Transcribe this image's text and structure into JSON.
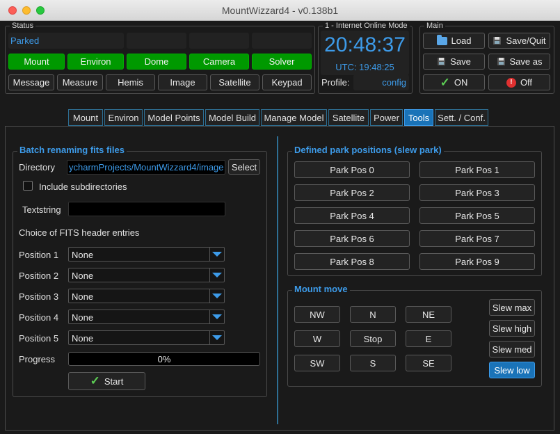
{
  "window": {
    "title": "MountWizzard4 - v0.138b1"
  },
  "status": {
    "group_title": "Status",
    "text": "Parked",
    "indicators": [
      "Mount",
      "Environ",
      "Dome",
      "Camera",
      "Solver"
    ],
    "buttons": [
      "Message",
      "Measure",
      "Hemis",
      "Image",
      "Satellite",
      "Keypad"
    ]
  },
  "online": {
    "group_title": "1 - Internet Online Mode",
    "time": "20:48:37",
    "utc": "UTC: 19:48:25",
    "profile_label": "Profile:",
    "profile_value": "config"
  },
  "main": {
    "group_title": "Main",
    "load": "Load",
    "save_quit": "Save/Quit",
    "save": "Save",
    "save_as": "Save as",
    "on": "ON",
    "off": "Off"
  },
  "tabs": [
    "Mount",
    "Environ",
    "Model Points",
    "Model Build",
    "Manage Model",
    "Satellite",
    "Power",
    "Tools",
    "Sett. / Conf."
  ],
  "active_tab": "Tools",
  "batch": {
    "title": "Batch renaming fits files",
    "directory_label": "Directory",
    "directory_value": "ycharmProjects/MountWizzard4/image",
    "select_button": "Select",
    "include_subdirs": "Include subdirectories",
    "include_subdirs_checked": false,
    "textstring_label": "Textstring",
    "textstring_value": "",
    "choice_label": "Choice of FITS header entries",
    "positions": [
      {
        "label": "Position 1",
        "value": "None"
      },
      {
        "label": "Position 2",
        "value": "None"
      },
      {
        "label": "Position 3",
        "value": "None"
      },
      {
        "label": "Position 4",
        "value": "None"
      },
      {
        "label": "Position 5",
        "value": "None"
      }
    ],
    "progress_label": "Progress",
    "progress_value": 0,
    "progress_text": "0%",
    "start_button": "Start"
  },
  "park": {
    "title": "Defined park positions (slew  park)",
    "positions": [
      "Park Pos 0",
      "Park Pos 1",
      "Park Pos 2",
      "Park Pos 3",
      "Park Pos 4",
      "Park Pos 5",
      "Park Pos 6",
      "Park Pos 7",
      "Park Pos 8",
      "Park Pos 9"
    ]
  },
  "move": {
    "title": "Mount move",
    "grid": [
      "NW",
      "N",
      "NE",
      "W",
      "Stop",
      "E",
      "SW",
      "S",
      "SE"
    ],
    "slew": [
      "Slew max",
      "Slew high",
      "Slew med",
      "Slew low"
    ],
    "active_slew": "Slew low"
  },
  "colors": {
    "accent": "#3d9be9",
    "status_green": "#009900",
    "active_blue": "#1a73b8"
  }
}
